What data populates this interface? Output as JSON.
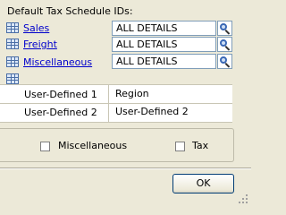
{
  "tax_schedules": {
    "section_label": "Default Tax Schedule IDs:",
    "rows": [
      {
        "label": "Sales",
        "value": "ALL DETAILS"
      },
      {
        "label": "Freight",
        "value": "ALL DETAILS"
      },
      {
        "label": "Miscellaneous",
        "value": "ALL DETAILS"
      }
    ]
  },
  "user_defined": {
    "rows": [
      {
        "label": "User-Defined 1",
        "value": "Region"
      },
      {
        "label": "User-Defined 2",
        "value": "User-Defined 2"
      }
    ]
  },
  "options": {
    "misc_label": "Miscellaneous",
    "misc_checked": false,
    "tax_label": "Tax",
    "tax_checked": false
  },
  "buttons": {
    "ok_label": "OK"
  },
  "icons": {
    "row_icon": "grid-icon",
    "lookup_icon": "magnifier-icon"
  }
}
